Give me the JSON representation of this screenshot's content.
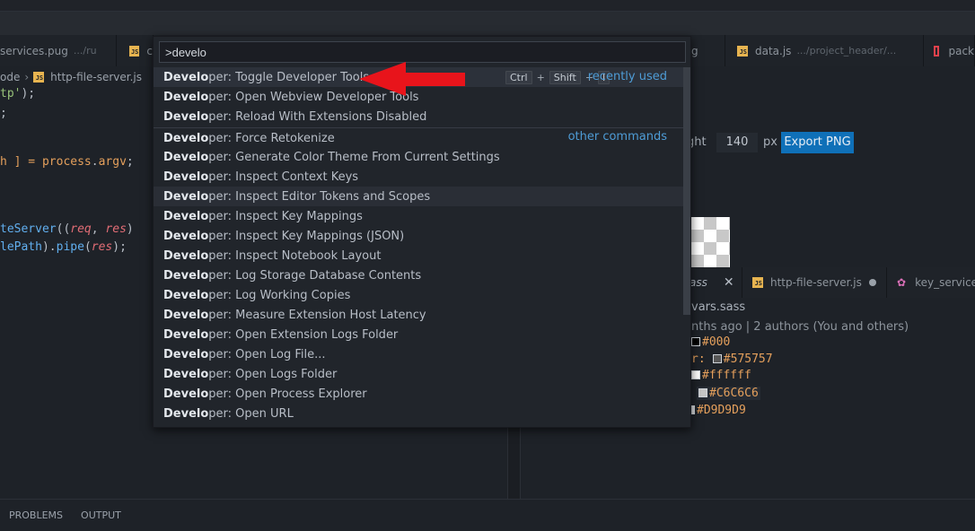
{
  "left_tabs": [
    {
      "name": "services.pug",
      "path": ".../ru"
    },
    {
      "name": "c",
      "path": ""
    }
  ],
  "right_tabs": [
    {
      "name": "g",
      "path": ""
    },
    {
      "name": "data.js",
      "path": ".../project_header/..."
    },
    {
      "name": "pack",
      "path": ""
    }
  ],
  "breadcrumbs": {
    "parent": "ode",
    "file": "http-file-server.js"
  },
  "code_lines": {
    "l1": "tp'",
    "l1_end": ");",
    "l2": ";",
    "l3_a": "h ] = ",
    "l3_b": "process",
    "l3_c": ".",
    "l3_d": "argv",
    "l3_e": ";",
    "l4_fn": "teServer",
    "l4_a": "((",
    "l4_req": "req",
    "l4_b": ", ",
    "l4_res": "res",
    "l4_c": ")",
    "l5_a": "lePath",
    "l5_b": ").",
    "l5_fn": "pipe",
    "l5_c": "(",
    "l5_res": "res",
    "l5_d": ");"
  },
  "export_controls": {
    "height_label": "ght",
    "height_value": "140",
    "unit": "px",
    "export_label": "Export PNG"
  },
  "bottom_tabs": [
    {
      "name": "ass"
    },
    {
      "name": "http-file-server.js"
    },
    {
      "name": "key_service"
    }
  ],
  "sass_view": {
    "file": "vars.sass",
    "blame": "nths ago | 2 authors (You and others)",
    "lines": [
      {
        "prefix": "",
        "hex": "#000",
        "swatch": "#000000"
      },
      {
        "prefix": "r:",
        "hex": "#575757",
        "swatch": "#575757"
      },
      {
        "prefix": "",
        "hex": "#ffffff",
        "swatch": "#ffffff"
      },
      {
        "prefix": "",
        "hex": "#C6C6C6",
        "swatch": "#C6C6C6"
      },
      {
        "prefix": "",
        "hex": "#D9D9D9",
        "swatch": "#D9D9D9"
      }
    ]
  },
  "panel_tabs": {
    "problems": "PROBLEMS",
    "output": "OUTPUT"
  },
  "palette": {
    "query": ">develo",
    "match": "Develo",
    "keys": {
      "k1": "Ctrl",
      "k2": "Shift",
      "k3": "I",
      "plus": "+"
    },
    "recently_used": "recently used",
    "other_commands": "other commands",
    "items": [
      {
        "rest": "per: Toggle Developer Tools"
      },
      {
        "rest": "per: Open Webview Developer Tools"
      },
      {
        "rest": "per: Reload With Extensions Disabled"
      },
      {
        "rest": "per: Force Retokenize"
      },
      {
        "rest": "per: Generate Color Theme From Current Settings"
      },
      {
        "rest": "per: Inspect Context Keys"
      },
      {
        "rest": "per: Inspect Editor Tokens and Scopes"
      },
      {
        "rest": "per: Inspect Key Mappings"
      },
      {
        "rest": "per: Inspect Key Mappings (JSON)"
      },
      {
        "rest": "per: Inspect Notebook Layout"
      },
      {
        "rest": "per: Log Storage Database Contents"
      },
      {
        "rest": "per: Log Working Copies"
      },
      {
        "rest": "per: Measure Extension Host Latency"
      },
      {
        "rest": "per: Open Extension Logs Folder"
      },
      {
        "rest": "per: Open Log File..."
      },
      {
        "rest": "per: Open Logs Folder"
      },
      {
        "rest": "per: Open Process Explorer"
      },
      {
        "rest": "per: Open URL"
      }
    ]
  },
  "colors": {
    "accent": "#0f70b8",
    "link": "#4e9cd6",
    "arrow": "#e8141b"
  }
}
